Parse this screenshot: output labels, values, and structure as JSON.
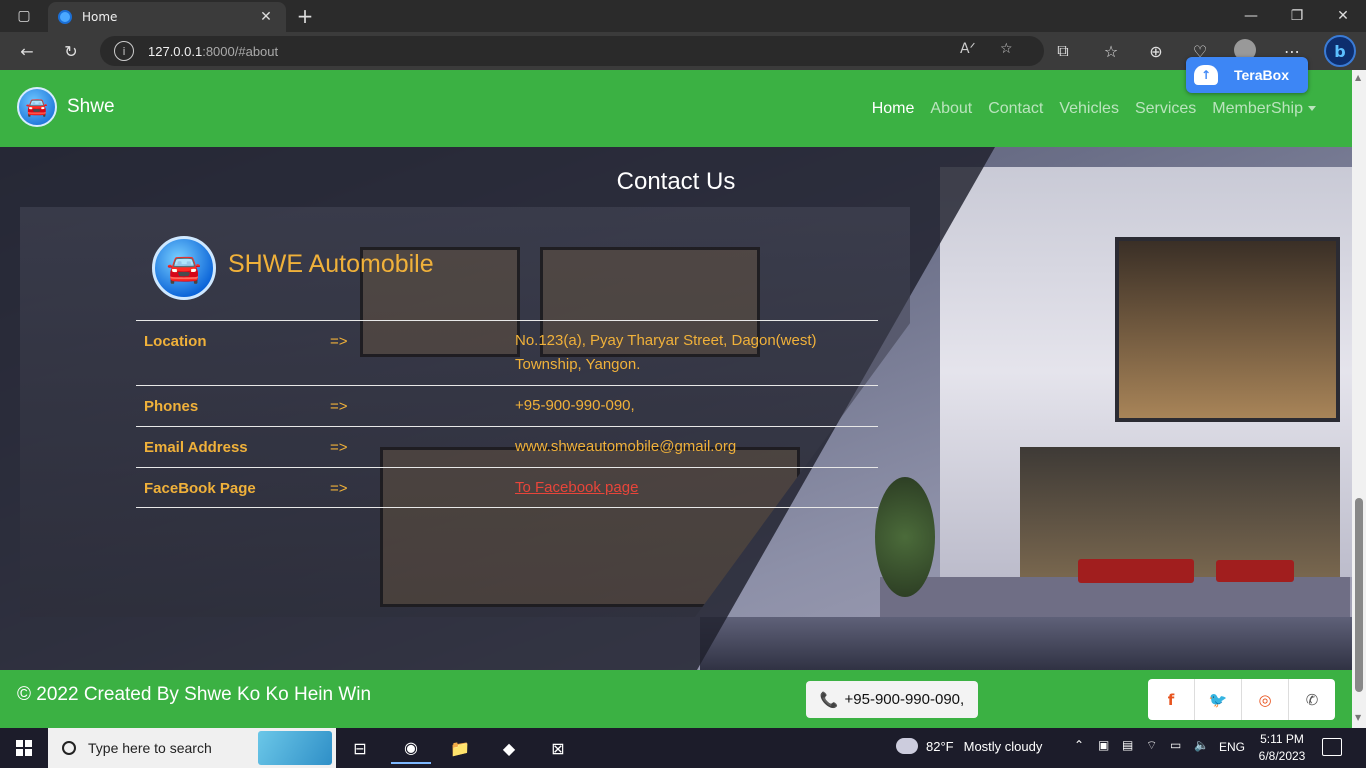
{
  "browser": {
    "tab_title": "Home",
    "url_host": "127.0.0.1",
    "url_rest": ":8000/#about"
  },
  "extension": {
    "terabox_label": "TeraBox"
  },
  "nav": {
    "brand": "Shwe",
    "links": [
      "Home",
      "About",
      "Contact",
      "Vehicles",
      "Services",
      "MemberShip"
    ],
    "active": "Home"
  },
  "contact": {
    "title": "Contact Us",
    "company_name": "SHWE Automobile",
    "rows": [
      {
        "label": "Location",
        "arrow": "=>",
        "value": "No.123(a), Pyay Tharyar Street, Dagon(west) Township, Yangon."
      },
      {
        "label": "Phones",
        "arrow": "=>",
        "value": "+95-900-990-090,"
      },
      {
        "label": "Email Address",
        "arrow": "=>",
        "value": "www.shweautomobile@gmail.org"
      },
      {
        "label": "FaceBook Page",
        "arrow": "=>",
        "value": "To Facebook page"
      }
    ]
  },
  "footer": {
    "copyright": "© 2022 Created By Shwe Ko Ko Hein Win",
    "phone": "+95-900-990-090,",
    "social_icons": [
      "facebook-icon",
      "twitter-icon",
      "instagram-icon",
      "whatsapp-icon"
    ]
  },
  "taskbar": {
    "search_placeholder": "Type here to search",
    "weather_temp": "82°F",
    "weather_desc": "Mostly cloudy",
    "language": "ENG",
    "time": "5:11 PM",
    "date": "6/8/2023"
  },
  "colors": {
    "nav_green": "#3bb143",
    "accent_orange": "#f0b13a",
    "link_red": "#e8453a"
  }
}
